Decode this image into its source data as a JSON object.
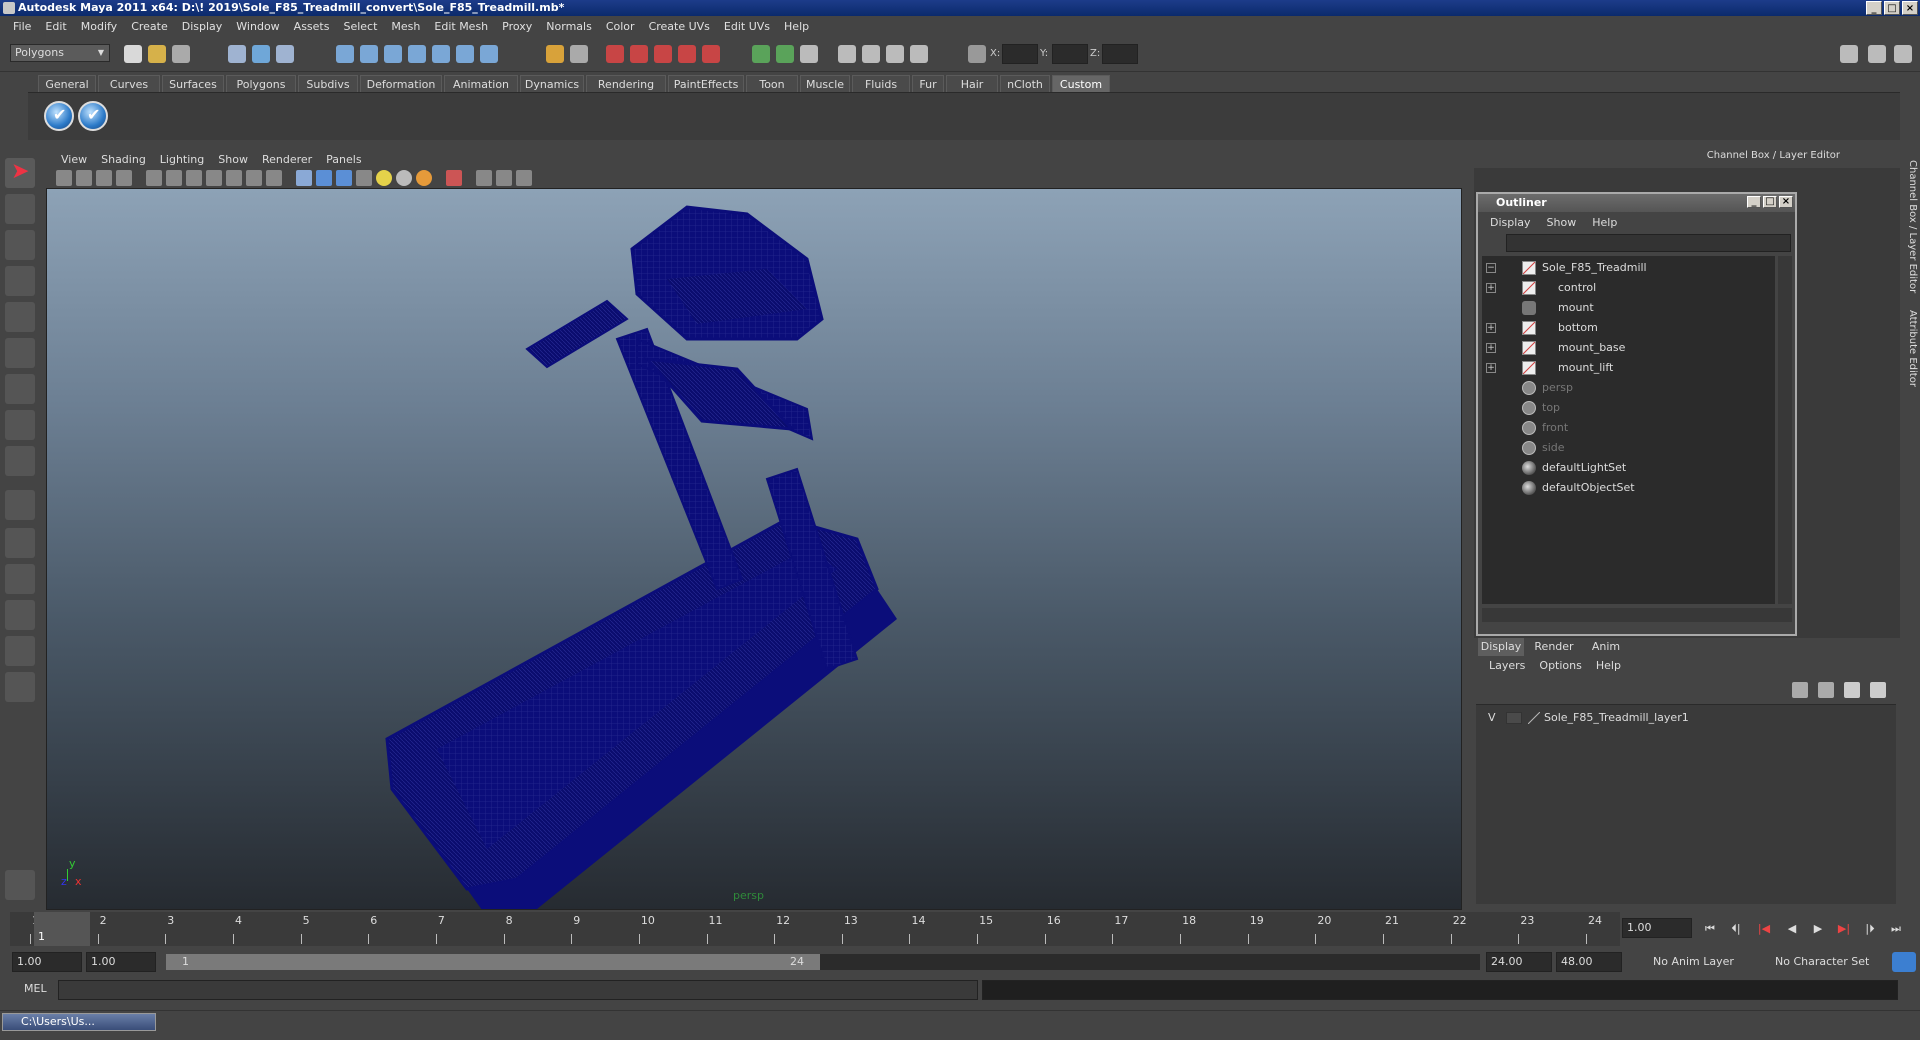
{
  "window": {
    "title": "Autodesk Maya 2011 x64: D:\\! 2019\\Sole_F85_Treadmill_convert\\Sole_F85_Treadmill.mb*"
  },
  "menubar": [
    "File",
    "Edit",
    "Modify",
    "Create",
    "Display",
    "Window",
    "Assets",
    "Select",
    "Mesh",
    "Edit Mesh",
    "Proxy",
    "Normals",
    "Color",
    "Create UVs",
    "Edit UVs",
    "Help"
  ],
  "statusline": {
    "mode": "Polygons",
    "x_label": "X:",
    "y_label": "Y:",
    "z_label": "Z:"
  },
  "shelf_tabs": [
    "General",
    "Curves",
    "Surfaces",
    "Polygons",
    "Subdivs",
    "Deformation",
    "Animation",
    "Dynamics",
    "Rendering",
    "PaintEffects",
    "Toon",
    "Muscle",
    "Fluids",
    "Fur",
    "Hair",
    "nCloth",
    "Custom"
  ],
  "active_shelf_tab": "Custom",
  "panel_menu": [
    "View",
    "Shading",
    "Lighting",
    "Show",
    "Renderer",
    "Panels"
  ],
  "viewport": {
    "camera": "persp",
    "axis_y": "y",
    "axis_x": "x",
    "axis_z": "z"
  },
  "channel_box": {
    "title": "Channel Box / Layer Editor"
  },
  "side_tabs": [
    "Channel Box / Layer Editor",
    "Attribute Editor"
  ],
  "outliner": {
    "title": "Outliner",
    "menu": [
      "Display",
      "Show",
      "Help"
    ],
    "items": [
      {
        "label": "Sole_F85_Treadmill",
        "icon": "transform-icon",
        "expand": "−",
        "indent": 0,
        "dim": false
      },
      {
        "label": "control",
        "icon": "transform-icon",
        "expand": "+",
        "indent": 1,
        "dim": false
      },
      {
        "label": "mount",
        "icon": "locator-icon",
        "expand": "",
        "indent": 1,
        "dim": false
      },
      {
        "label": "bottom",
        "icon": "transform-icon",
        "expand": "+",
        "indent": 1,
        "dim": false
      },
      {
        "label": "mount_base",
        "icon": "transform-icon",
        "expand": "+",
        "indent": 1,
        "dim": false
      },
      {
        "label": "mount_lift",
        "icon": "transform-icon",
        "expand": "+",
        "indent": 1,
        "dim": false
      },
      {
        "label": "persp",
        "icon": "camera-icon",
        "expand": "",
        "indent": 0,
        "dim": true
      },
      {
        "label": "top",
        "icon": "camera-icon",
        "expand": "",
        "indent": 0,
        "dim": true
      },
      {
        "label": "front",
        "icon": "camera-icon",
        "expand": "",
        "indent": 0,
        "dim": true
      },
      {
        "label": "side",
        "icon": "camera-icon",
        "expand": "",
        "indent": 0,
        "dim": true
      },
      {
        "label": "defaultLightSet",
        "icon": "set-icon",
        "expand": "",
        "indent": 0,
        "dim": false
      },
      {
        "label": "defaultObjectSet",
        "icon": "set-icon",
        "expand": "",
        "indent": 0,
        "dim": false
      }
    ]
  },
  "layer_editor": {
    "tabs": [
      "Display",
      "Render",
      "Anim"
    ],
    "menu": [
      "Layers",
      "Options",
      "Help"
    ],
    "layers": [
      {
        "visible": "V",
        "name": "Sole_F85_Treadmill_layer1"
      }
    ]
  },
  "time_slider": {
    "ticks": [
      "1",
      "2",
      "3",
      "4",
      "5",
      "6",
      "7",
      "8",
      "9",
      "10",
      "11",
      "12",
      "13",
      "14",
      "15",
      "16",
      "17",
      "18",
      "19",
      "20",
      "21",
      "22",
      "23",
      "24"
    ],
    "current_marker": "1",
    "current_frame": "1.00"
  },
  "range_slider": {
    "start_time": "1.00",
    "playback_start": "1.00",
    "range_min_label": "1",
    "range_max_label": "24",
    "playback_end": "24.00",
    "end_time": "48.00",
    "anim_layer": "No Anim Layer",
    "character_set": "No Character Set"
  },
  "command_line": {
    "label": "MEL"
  },
  "taskbar": {
    "item": "C:\\Users\\Us..."
  },
  "colors": {
    "wireframe": "#0b0d7a",
    "title_bar": "#0b2a6b",
    "ui_bg": "#444444"
  }
}
